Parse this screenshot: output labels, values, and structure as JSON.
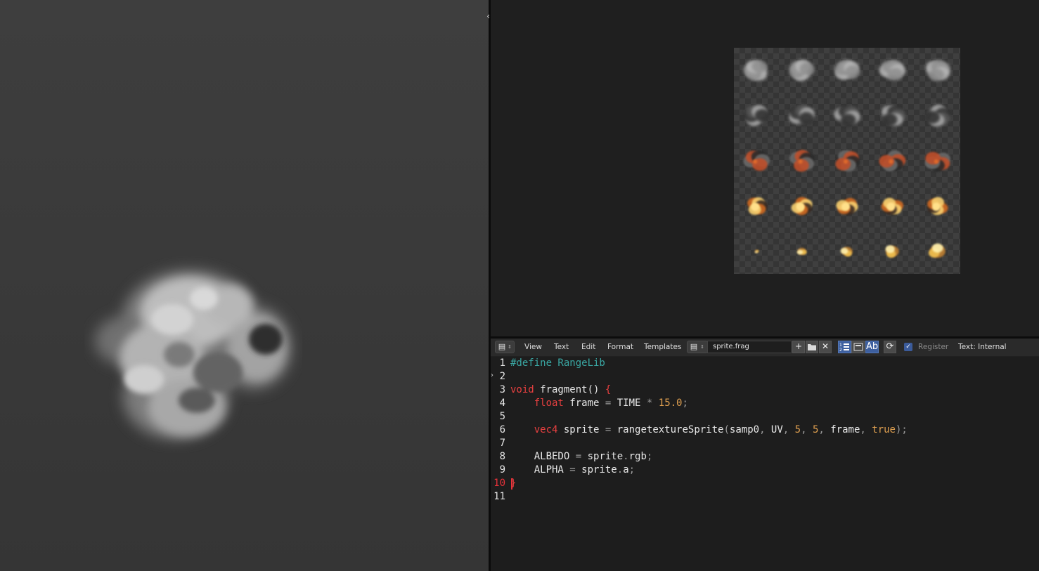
{
  "text_editor": {
    "menu": [
      "View",
      "Text",
      "Edit",
      "Format",
      "Templates"
    ],
    "file_name": "sprite.frag",
    "register_label": "Register",
    "status": "Text: Internal",
    "toggle_labels": {
      "word_wrap": "Ab"
    },
    "icons": {
      "editor_type": "text-editor-icon",
      "new": "plus-icon",
      "open": "folder-icon",
      "unlink": "close-icon",
      "line_numbers": "line-numbers-icon",
      "syntax": "syntax-highlight-icon",
      "reload": "refresh-icon"
    },
    "active_line": 10,
    "line_numbers": [
      "1",
      "2",
      "3",
      "4",
      "5",
      "6",
      "7",
      "8",
      "9",
      "10",
      "11"
    ]
  },
  "code": {
    "l1_pp": "#define RangeLib",
    "l3_kw": "void",
    "l3_rest": " fragment() ",
    "l3_brace": "{",
    "l4_indent": "    ",
    "l4_kw": "float",
    "l4_a": " frame ",
    "l4_eq": "=",
    "l4_b": " TIME ",
    "l4_mul": "*",
    "l4_num": " 15.0",
    "l4_semi": ";",
    "l6_kw": "vec4",
    "l6_a": " sprite ",
    "l6_eq": "=",
    "l6_b": " rangetextureSprite",
    "l6_p1": "(",
    "l6_c": "samp0",
    "l6_com1": ",",
    "l6_d": " UV",
    "l6_com2": ",",
    "l6_n1": " 5",
    "l6_com3": ",",
    "l6_n2": " 5",
    "l6_com4": ",",
    "l6_e": " frame",
    "l6_com5": ",",
    "l6_true": " true",
    "l6_end": ");",
    "l8_a": "    ALBEDO ",
    "l8_eq": "=",
    "l8_b": " sprite",
    "l8_dot": ".",
    "l8_c": "rgb",
    "l8_semi": ";",
    "l9_a": "    ALPHA ",
    "l9_eq": "=",
    "l9_b": " sprite",
    "l9_dot": ".",
    "l9_c": "a",
    "l9_semi": ";",
    "l10_brace": "}"
  },
  "colors": {
    "keyword": "#e84040",
    "preprocessor": "#3aa8a4",
    "number": "#e0a050",
    "accent": "#3d5f9f"
  },
  "sprite_sheet": {
    "rows": 5,
    "columns": 5
  }
}
